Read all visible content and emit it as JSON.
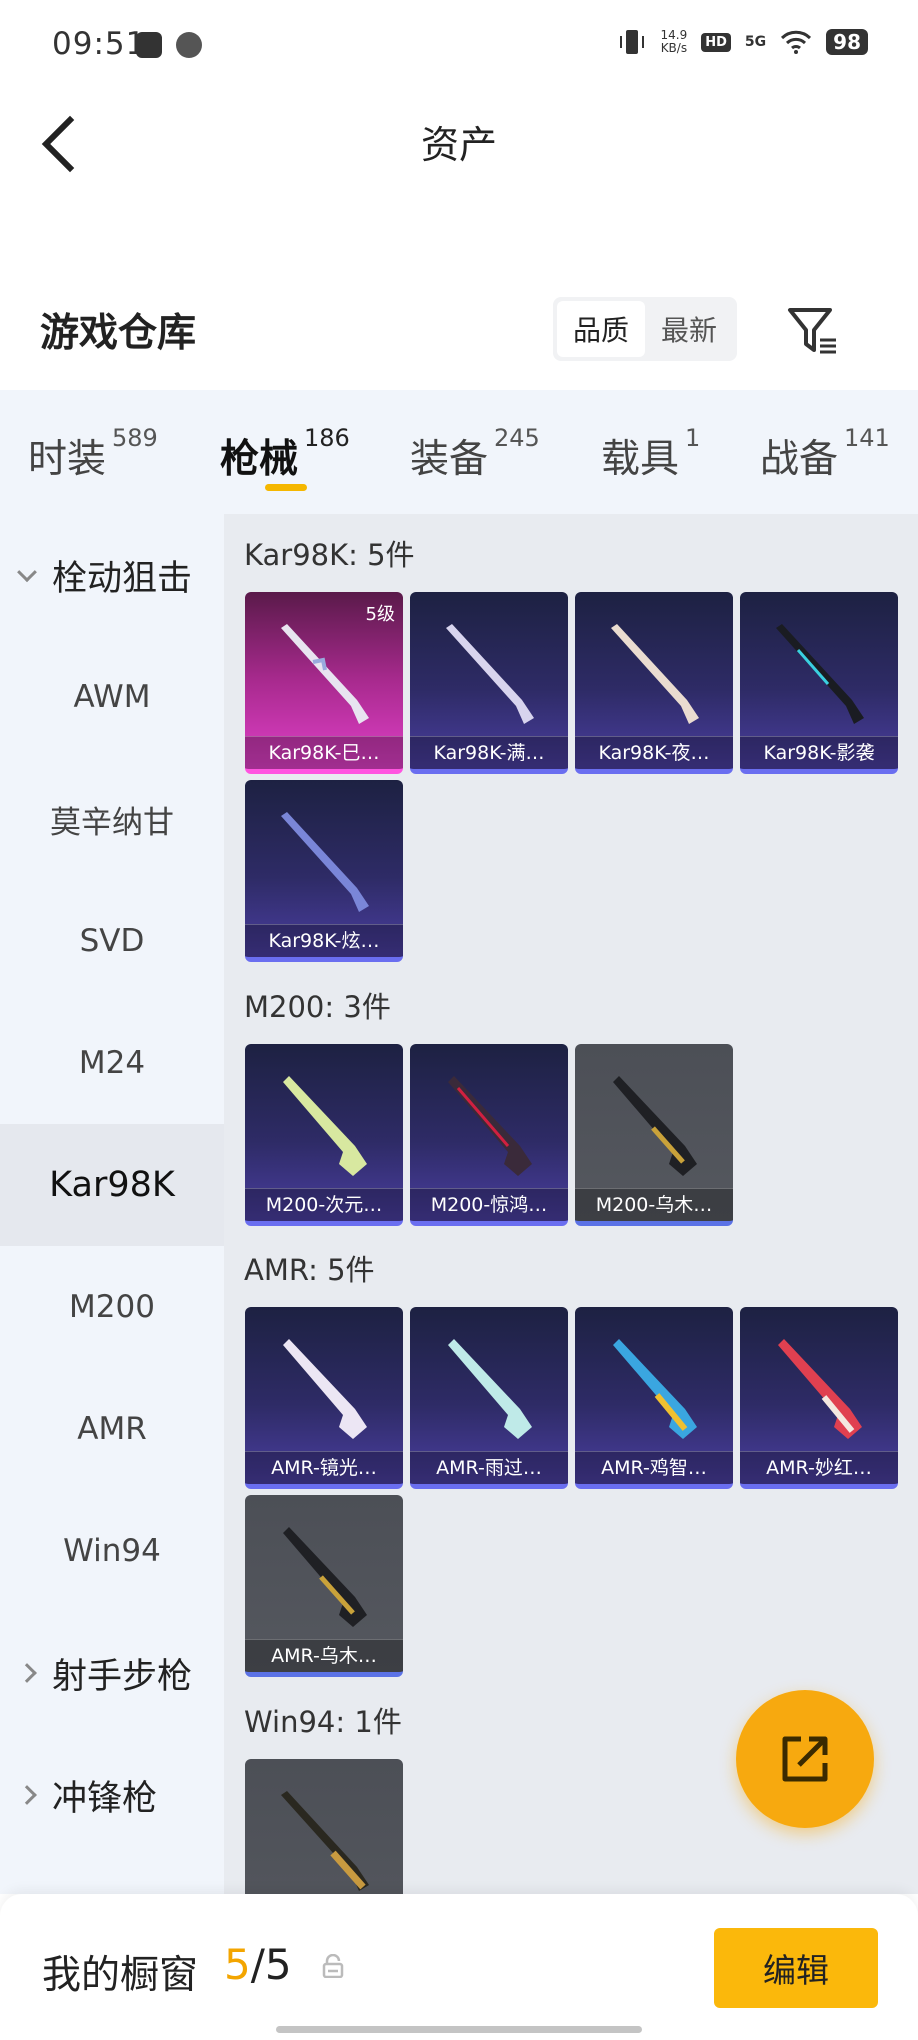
{
  "status_bar": {
    "time": "09:51",
    "net_speed_value": "14.9",
    "net_speed_unit": "KB/s",
    "hd": "HD",
    "network": "5G",
    "battery": "98"
  },
  "header": {
    "title": "资产"
  },
  "warehouse": {
    "title": "游戏仓库",
    "sort_options": [
      "品质",
      "最新"
    ],
    "active_sort": "品质"
  },
  "tabs": [
    {
      "label": "时装",
      "count": "589"
    },
    {
      "label": "枪械",
      "count": "186",
      "active": true
    },
    {
      "label": "装备",
      "count": "245"
    },
    {
      "label": "载具",
      "count": "1"
    },
    {
      "label": "战备",
      "count": "141"
    }
  ],
  "sidebar": {
    "items": [
      {
        "label": "栓动狙击",
        "type": "group",
        "expanded": true
      },
      {
        "label": "AWM"
      },
      {
        "label": "莫辛纳甘"
      },
      {
        "label": "SVD"
      },
      {
        "label": "M24"
      },
      {
        "label": "Kar98K",
        "active": true
      },
      {
        "label": "M200"
      },
      {
        "label": "AMR"
      },
      {
        "label": "Win94"
      },
      {
        "label": "射手步枪",
        "type": "group",
        "expanded": false
      },
      {
        "label": "冲锋枪",
        "type": "group",
        "expanded": false
      }
    ]
  },
  "sections": [
    {
      "title": "Kar98K: 5件",
      "items": [
        {
          "label": "Kar98K-巳…",
          "rarity": "legendary",
          "level": "5级"
        },
        {
          "label": "Kar98K-满…",
          "rarity": "epic"
        },
        {
          "label": "Kar98K-夜…",
          "rarity": "epic"
        },
        {
          "label": "Kar98K-影袭",
          "rarity": "epic"
        },
        {
          "label": "Kar98K-炫…",
          "rarity": "epic"
        }
      ]
    },
    {
      "title": "M200: 3件",
      "items": [
        {
          "label": "M200-次元…",
          "rarity": "epic"
        },
        {
          "label": "M200-惊鸿…",
          "rarity": "epic"
        },
        {
          "label": "M200-乌木…",
          "rarity": "common"
        }
      ]
    },
    {
      "title": "AMR: 5件",
      "items": [
        {
          "label": "AMR-镜光…",
          "rarity": "epic"
        },
        {
          "label": "AMR-雨过…",
          "rarity": "epic"
        },
        {
          "label": "AMR-鸡智…",
          "rarity": "epic"
        },
        {
          "label": "AMR-妙红…",
          "rarity": "epic"
        },
        {
          "label": "AMR-乌木…",
          "rarity": "common"
        }
      ]
    },
    {
      "title": "Win94: 1件",
      "items": [
        {
          "label": "",
          "rarity": "common"
        }
      ]
    }
  ],
  "bottom_bar": {
    "showcase_label": "我的橱窗",
    "showcase_used": "5",
    "showcase_sep": "/",
    "showcase_total": "5",
    "edit_label": "编辑"
  },
  "colors": {
    "accent": "#f5b700",
    "edit_button": "#fbb80b",
    "fab": "#f7a90f",
    "legendary": "#e040c8",
    "epic": "#4a3ea0",
    "common": "#55585f"
  },
  "icons": {
    "back": "chevron-left-icon",
    "filter": "filter-icon",
    "fab": "share-external-icon",
    "lock": "lock-icon"
  }
}
